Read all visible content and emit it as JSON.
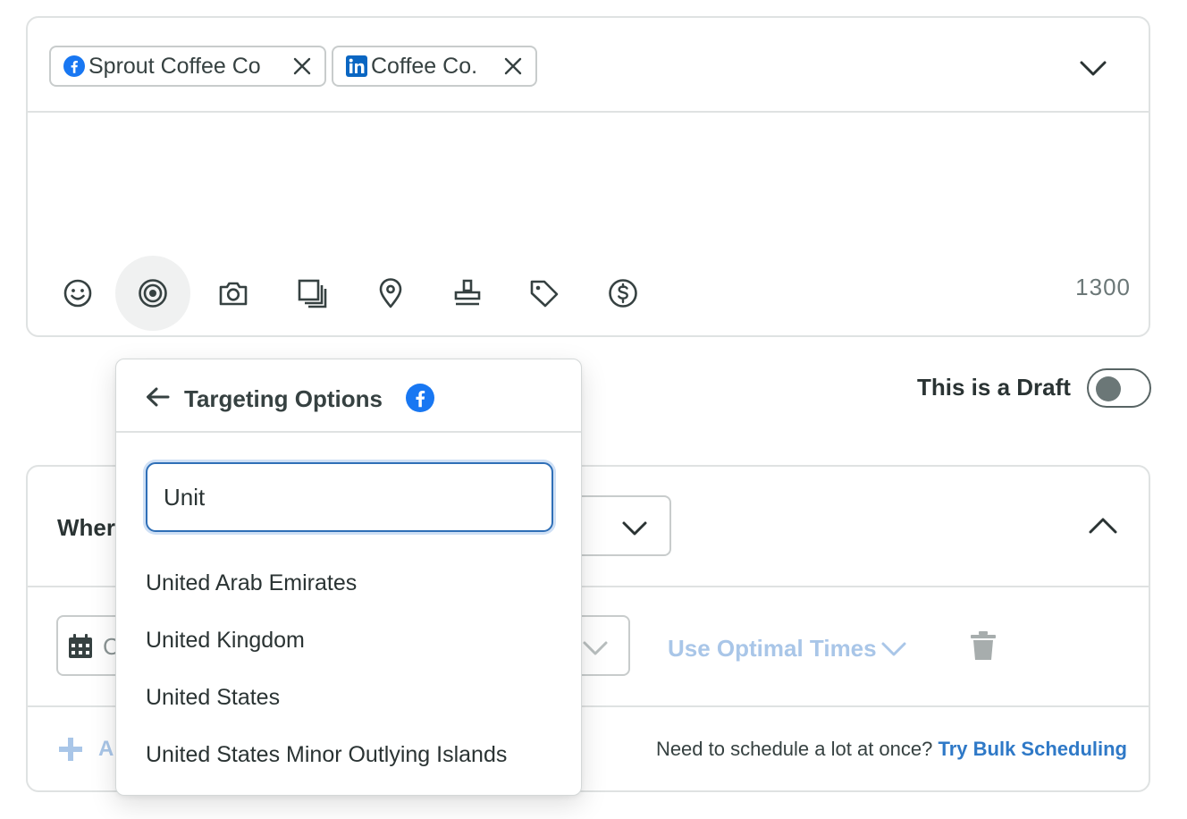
{
  "composer": {
    "profiles": [
      {
        "network_icon": "facebook-icon",
        "label": "Sprout Coffee Co"
      },
      {
        "network_icon": "linkedin-icon",
        "label": "Coffee Co."
      }
    ],
    "toolbar_icons": [
      "emoji-icon",
      "targeting-icon",
      "camera-icon",
      "gallery-icon",
      "location-icon",
      "stamp-icon",
      "tag-icon",
      "dollar-icon"
    ],
    "char_count": "1300"
  },
  "draft": {
    "label": "This is a Draft",
    "enabled": false
  },
  "schedule": {
    "when_label": "Wher",
    "date_placeholder": "C",
    "optimal_label": "Use Optimal Times",
    "add_label": "A",
    "bulk_prompt": "Need to schedule a lot at once?",
    "bulk_link": "Try Bulk Scheduling"
  },
  "targeting": {
    "title": "Targeting Options",
    "search_value": "Unit",
    "results": [
      "United Arab Emirates",
      "United Kingdom",
      "United States",
      "United States Minor Outlying Islands"
    ]
  },
  "colors": {
    "facebook": "#1877f2",
    "linkedin": "#0a66c2",
    "link": "#2f79c7",
    "disabled_link": "#a9c6e8",
    "focus_border": "#2f6fb7"
  }
}
